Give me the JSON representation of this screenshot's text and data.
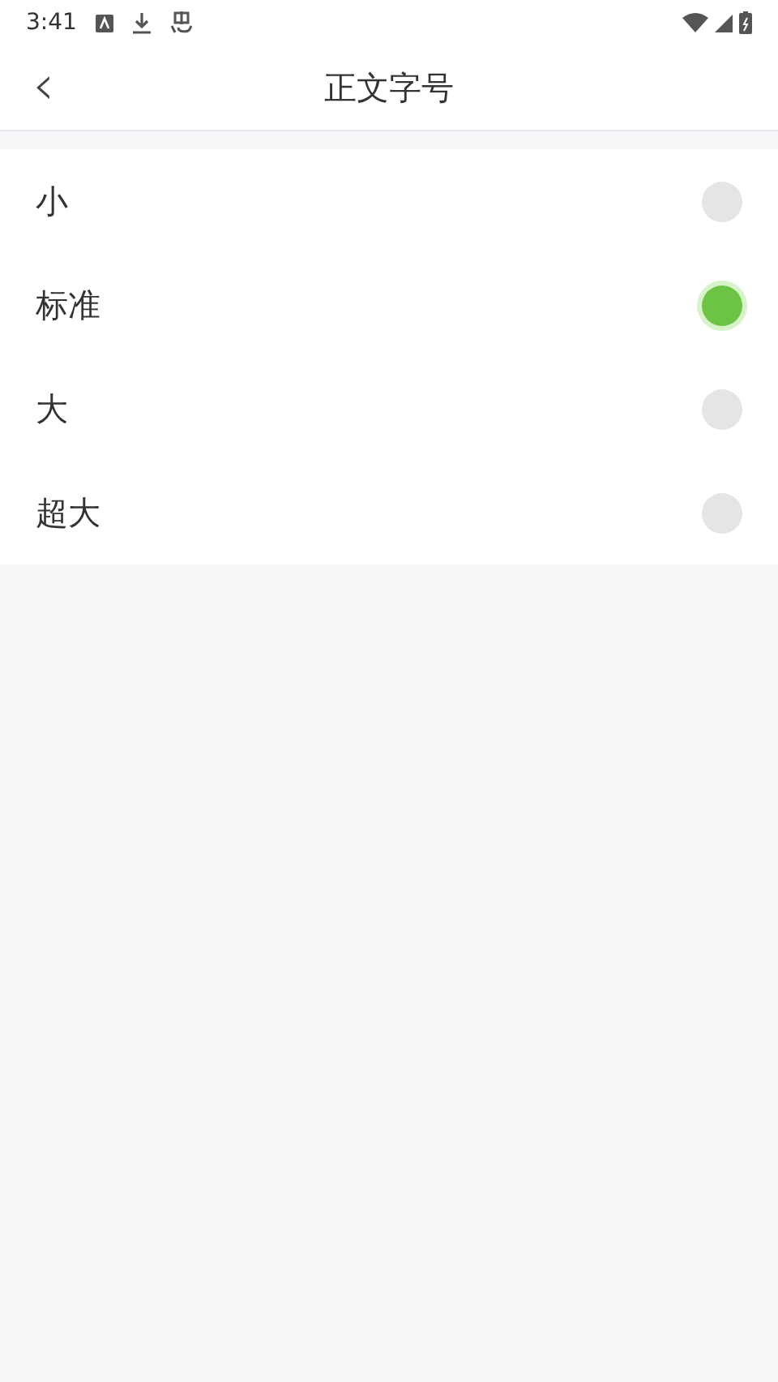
{
  "status_bar": {
    "time": "3:41"
  },
  "header": {
    "back": "‹",
    "title": "正文字号"
  },
  "options": [
    {
      "label": "小",
      "selected": false
    },
    {
      "label": "标准",
      "selected": true
    },
    {
      "label": "大",
      "selected": false
    },
    {
      "label": "超大",
      "selected": false
    }
  ]
}
